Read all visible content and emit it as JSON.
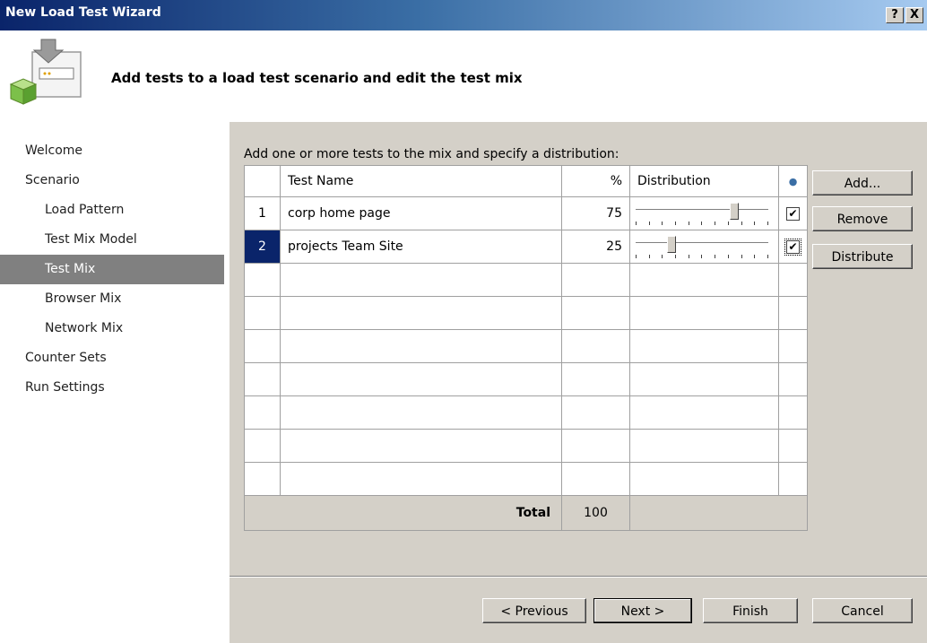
{
  "window": {
    "title": "New Load Test Wizard",
    "help_glyph": "?",
    "close_glyph": "X"
  },
  "header": {
    "heading": "Add tests to a load test scenario and edit the test mix"
  },
  "nav": {
    "items": [
      {
        "label": "Welcome"
      },
      {
        "label": "Scenario"
      },
      {
        "label": "Load Pattern"
      },
      {
        "label": "Test Mix Model"
      },
      {
        "label": "Test Mix"
      },
      {
        "label": "Browser Mix"
      },
      {
        "label": "Network Mix"
      },
      {
        "label": "Counter Sets"
      },
      {
        "label": "Run Settings"
      }
    ],
    "selected": "Test Mix"
  },
  "main": {
    "instruction": "Add one or more tests to the mix and specify a distribution:",
    "table": {
      "columns": [
        "",
        "Test Name",
        "%",
        "Distribution",
        "icon"
      ],
      "rows": [
        {
          "num": "1",
          "name": "corp home page",
          "percent": "75",
          "distribution_fraction": 0.75,
          "checked": true
        },
        {
          "num": "2",
          "name": "projects Team Site",
          "percent": "25",
          "distribution_fraction": 0.25,
          "checked": true
        }
      ],
      "empty_rows": 7,
      "total_label": "Total",
      "total_value": "100"
    },
    "side_buttons": {
      "add": "Add...",
      "remove": "Remove",
      "distribute": "Distribute"
    }
  },
  "footer": {
    "previous": "< Previous",
    "next": "Next >",
    "finish": "Finish",
    "cancel": "Cancel"
  },
  "colors": {
    "selection": "#0a246a",
    "dialog_face": "#d4d0c8",
    "nav_selected": "#808080"
  },
  "icons": {
    "wizard_icon": "load-test-wizard-icon",
    "column_icon": "lock-icon"
  }
}
